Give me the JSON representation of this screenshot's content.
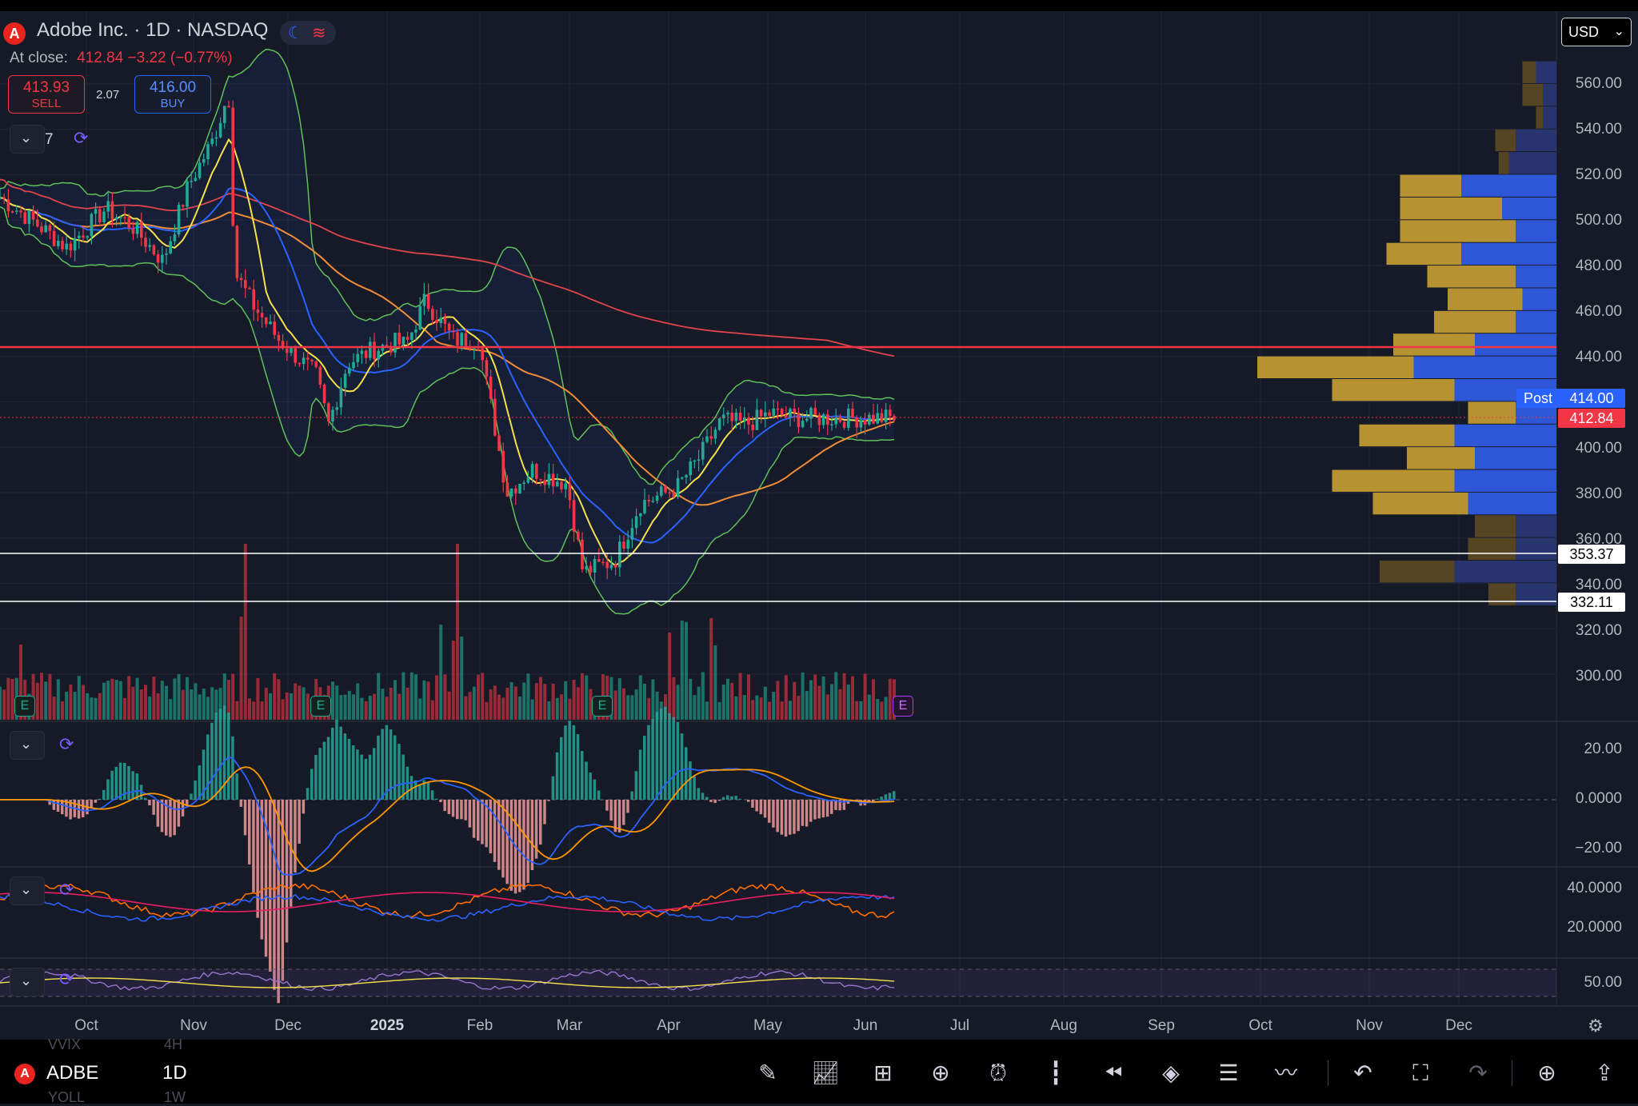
{
  "header": {
    "title": "Adobe Inc. · 1D · NASDAQ",
    "at_close_label": "At close:",
    "at_close_value": "412.84  −3.22 (−0.77%)",
    "sell_price": "413.93",
    "sell_label": "SELL",
    "spread": "2.07",
    "buy_price": "416.00",
    "buy_label": "BUY",
    "indicator_count": "7"
  },
  "currency": "USD",
  "price_axis": {
    "labels": [
      "560.00",
      "540.00",
      "520.00",
      "500.00",
      "480.00",
      "460.00",
      "440.00",
      "400.00",
      "380.00",
      "360.00",
      "340.00",
      "320.00",
      "300.00"
    ],
    "post_label": "Post",
    "post_price": "414.00",
    "last_price": "412.84",
    "level_1": "353.37",
    "level_2": "332.11"
  },
  "macd_axis": [
    "20.00",
    "0.0000",
    "−20.00"
  ],
  "dmi_axis": [
    "40.0000",
    "20.0000"
  ],
  "rsi_axis": [
    "50.00"
  ],
  "time_axis": [
    "Oct",
    "Nov",
    "Dec",
    "2025",
    "Feb",
    "Mar",
    "Apr",
    "May",
    "Jun",
    "Jul",
    "Aug",
    "Sep",
    "Oct",
    "Nov",
    "Dec"
  ],
  "earnings_marker": "E",
  "bottom_bar": {
    "ticker": "ADBE",
    "timeframe": "1D",
    "ghost_ticker": "VVIX",
    "ghost_timeframe": "4H",
    "ghost_ticker_2": "YOLL",
    "ghost_timeframe_2": "1W"
  },
  "colors": {
    "background": "#161a26",
    "up": "#22ab94",
    "down": "#f23645",
    "level_line": "#f23645",
    "bollinger": "#5fbf5a",
    "ma_fast": "#f5e04a",
    "ma_mid": "#2962ff",
    "ma_slow": "#f08c3a",
    "ma_200": "#e0444d"
  },
  "chart_data": {
    "type": "candlestick",
    "symbol": "ADBE",
    "interval": "1D",
    "ylim": [
      290,
      570
    ],
    "price_path": [
      [
        "Sep 20",
        525
      ],
      [
        "Oct 1",
        510
      ],
      [
        "Oct 10",
        500
      ],
      [
        "Oct 20",
        488
      ],
      [
        "Oct 31",
        505
      ],
      [
        "Nov 8",
        498
      ],
      [
        "Nov 18",
        482
      ],
      [
        "Nov 26",
        515
      ],
      [
        "Dec 5",
        535
      ],
      [
        "Dec 10",
        556
      ],
      [
        "Dec 12",
        477
      ],
      [
        "Dec 18",
        462
      ],
      [
        "Dec 26",
        447
      ],
      [
        "Jan 6",
        432
      ],
      [
        "Jan 10",
        410
      ],
      [
        "Jan 16",
        437
      ],
      [
        "Jan 24",
        443
      ],
      [
        "Jan 31",
        446
      ],
      [
        "Feb 6",
        445
      ],
      [
        "Feb 12",
        465
      ],
      [
        "Feb 21",
        447
      ],
      [
        "Mar 3",
        448
      ],
      [
        "Mar 12",
        380
      ],
      [
        "Mar 20",
        390
      ],
      [
        "Mar 31",
        384
      ],
      [
        "Apr 7",
        345
      ],
      [
        "Apr 17",
        350
      ],
      [
        "Apr 25",
        375
      ],
      [
        "May 5",
        382
      ],
      [
        "May 12",
        395
      ],
      [
        "May 19",
        412
      ],
      [
        "May 27",
        410
      ],
      [
        "Jun 3",
        415
      ],
      [
        "Jun 12",
        412.84
      ]
    ],
    "volume_profile": [
      {
        "price": 565,
        "up": 3,
        "down": 2
      },
      {
        "price": 555,
        "up": 2,
        "down": 3
      },
      {
        "price": 545,
        "up": 2,
        "down": 1
      },
      {
        "price": 535,
        "up": 6,
        "down": 3
      },
      {
        "price": 525,
        "up": 7,
        "down": 1.5
      },
      {
        "price": 515,
        "up": 14,
        "down": 9
      },
      {
        "price": 505,
        "up": 8,
        "down": 15
      },
      {
        "price": 495,
        "up": 6,
        "down": 17
      },
      {
        "price": 485,
        "up": 14,
        "down": 11
      },
      {
        "price": 475,
        "up": 6,
        "down": 13
      },
      {
        "price": 465,
        "up": 5,
        "down": 11
      },
      {
        "price": 455,
        "up": 6,
        "down": 12
      },
      {
        "price": 445,
        "up": 12,
        "down": 12
      },
      {
        "price": 435,
        "up": 21,
        "down": 23
      },
      {
        "price": 425,
        "up": 15,
        "down": 18
      },
      {
        "price": 415,
        "up": 6,
        "down": 7
      },
      {
        "price": 405,
        "up": 15,
        "down": 14
      },
      {
        "price": 395,
        "up": 12,
        "down": 10
      },
      {
        "price": 385,
        "up": 15,
        "down": 18
      },
      {
        "price": 375,
        "up": 13,
        "down": 14
      },
      {
        "price": 365,
        "up": 6,
        "down": 6
      },
      {
        "price": 355,
        "up": 6,
        "down": 7
      },
      {
        "price": 345,
        "up": 15,
        "down": 11
      },
      {
        "price": 335,
        "up": 6,
        "down": 4
      }
    ]
  }
}
